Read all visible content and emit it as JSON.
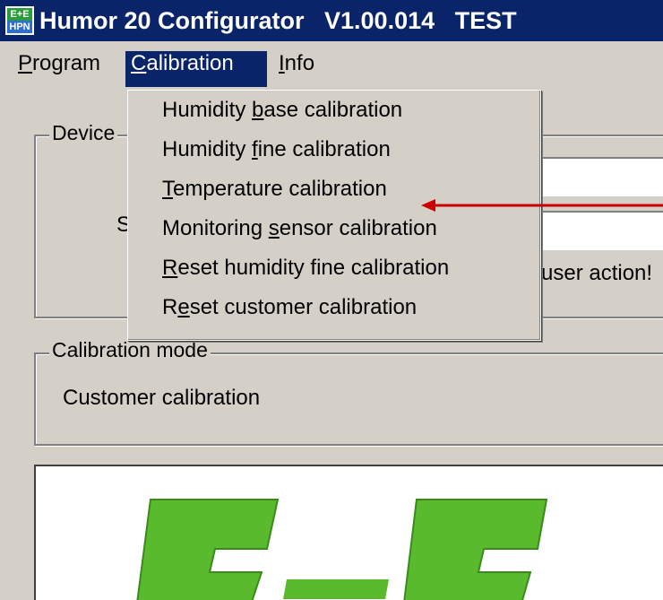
{
  "window": {
    "title": "Humor 20 Configurator   V1.00.014   TEST",
    "icon_top": "E+E",
    "icon_bottom": "HPN"
  },
  "menubar": {
    "items": [
      {
        "pre": "",
        "u": "P",
        "post": "rogram"
      },
      {
        "pre": "",
        "u": "C",
        "post": "alibration"
      },
      {
        "pre": "",
        "u": "I",
        "post": "nfo"
      }
    ]
  },
  "calibration_menu": {
    "items": [
      {
        "pre": "Humidity ",
        "u": "b",
        "post": "ase calibration"
      },
      {
        "pre": "Humidity ",
        "u": "f",
        "post": "ine calibration"
      },
      {
        "pre": "",
        "u": "T",
        "post": "emperature calibration"
      },
      {
        "pre": "Monitoring ",
        "u": "s",
        "post": "ensor calibration"
      },
      {
        "pre": "",
        "u": "R",
        "post": "eset humidity fine calibration"
      },
      {
        "pre": "R",
        "u": "e",
        "post": "set customer calibration"
      }
    ]
  },
  "device_group": {
    "label": "Device",
    "partial_char": "S",
    "status_text": "user action!"
  },
  "calibration_mode": {
    "label": "Calibration mode",
    "value": "Customer calibration"
  },
  "colors": {
    "titlebar": "#0a246a",
    "arrow": "#cc0000",
    "logo_green": "#5aba2e"
  }
}
